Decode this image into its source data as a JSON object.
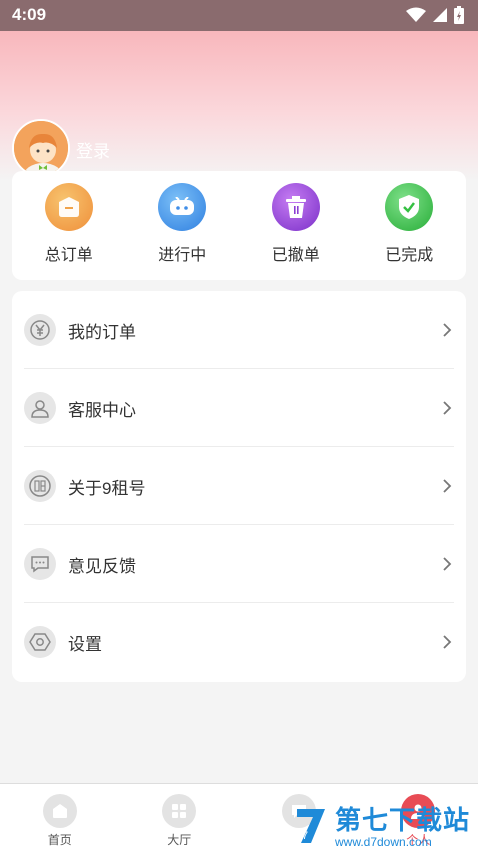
{
  "status_bar": {
    "time": "4:09"
  },
  "user": {
    "login_label": "登录"
  },
  "orders": [
    {
      "label": "总订单",
      "icon": "order-box-icon",
      "color": "#f0a34a"
    },
    {
      "label": "进行中",
      "icon": "gamepad-icon",
      "color": "#3f8ee8"
    },
    {
      "label": "已撤单",
      "icon": "trash-icon",
      "color": "#8b3fd3"
    },
    {
      "label": "已完成",
      "icon": "shield-check-icon",
      "color": "#35c042"
    }
  ],
  "menu": [
    {
      "label": "我的订单",
      "icon": "yen-icon"
    },
    {
      "label": "客服中心",
      "icon": "user-icon"
    },
    {
      "label": "关于9租号",
      "icon": "rent-icon"
    },
    {
      "label": "意见反馈",
      "icon": "chat-icon"
    },
    {
      "label": "设置",
      "icon": "settings-icon"
    }
  ],
  "tabbar": [
    {
      "label": "首页",
      "icon": "home-icon"
    },
    {
      "label": "大厅",
      "icon": "grid-icon"
    },
    {
      "label": "",
      "icon": "message-icon"
    },
    {
      "label": "个人",
      "icon": "person-icon",
      "active": true
    }
  ],
  "watermark": {
    "title": "第七下载站",
    "url": "www.d7down.com",
    "logo_text": "7"
  }
}
